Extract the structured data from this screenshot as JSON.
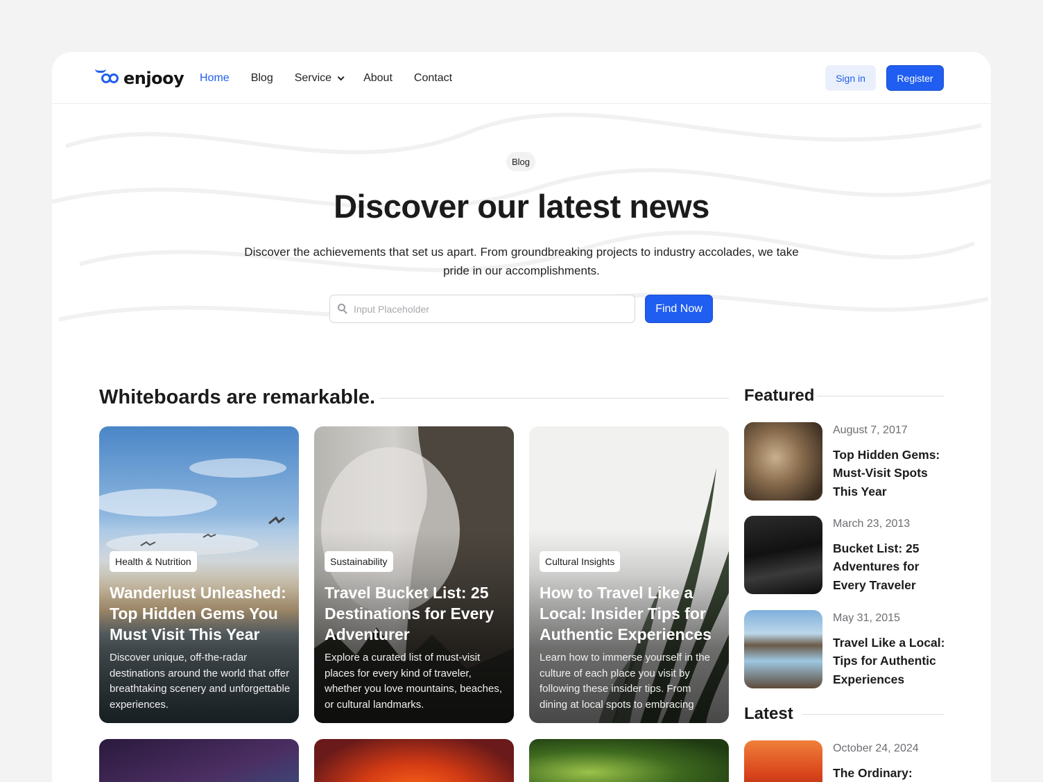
{
  "brand": {
    "name": "enjooy",
    "accent": "#1f5ef0"
  },
  "nav": {
    "items": [
      {
        "label": "Home",
        "active": true
      },
      {
        "label": "Blog"
      },
      {
        "label": "Service",
        "dropdown": true
      },
      {
        "label": "About"
      },
      {
        "label": "Contact"
      }
    ],
    "signin_label": "Sign in",
    "register_label": "Register"
  },
  "hero": {
    "badge": "Blog",
    "title": "Discover our latest news",
    "subtitle": "Discover the achievements that set us apart. From groundbreaking projects to industry accolades, we take pride in our accomplishments.",
    "search_placeholder": "Input Placeholder",
    "search_value": "",
    "find_label": "Find Now"
  },
  "main": {
    "heading": "Whiteboards are remarkable.",
    "cards": [
      {
        "tag": "Health & Nutrition",
        "title": "Wanderlust Unleashed: Top Hidden Gems You Must Visit This Year",
        "description": "Discover unique, off-the-radar destinations around the world that offer breathtaking scenery and unforgettable experiences."
      },
      {
        "tag": "Sustainability",
        "title": "Travel Bucket List: 25 Destinations for Every Adventurer",
        "description": "Explore a curated list of must-visit places for every kind of traveler, whether you love mountains, beaches, or cultural landmarks."
      },
      {
        "tag": "Cultural Insights",
        "title": "How to Travel Like a Local: Insider Tips for Authentic Experiences",
        "description": "Learn how to immerse yourself in the culture of each place you visit by following these insider tips. From dining at local spots to embracing"
      }
    ]
  },
  "sidebar": {
    "featured_heading": "Featured",
    "featured": [
      {
        "date": "August 7, 2017",
        "title": "Top Hidden Gems: Must-Visit Spots This Year"
      },
      {
        "date": "March 23, 2013",
        "title": "Bucket List: 25 Adventures for Every Traveler"
      },
      {
        "date": "May 31, 2015",
        "title": "Travel Like a Local: Tips for Authentic Experiences"
      }
    ],
    "latest_heading": "Latest",
    "latest": [
      {
        "date": "October 24, 2024",
        "title": "The Ordinary:"
      }
    ]
  }
}
